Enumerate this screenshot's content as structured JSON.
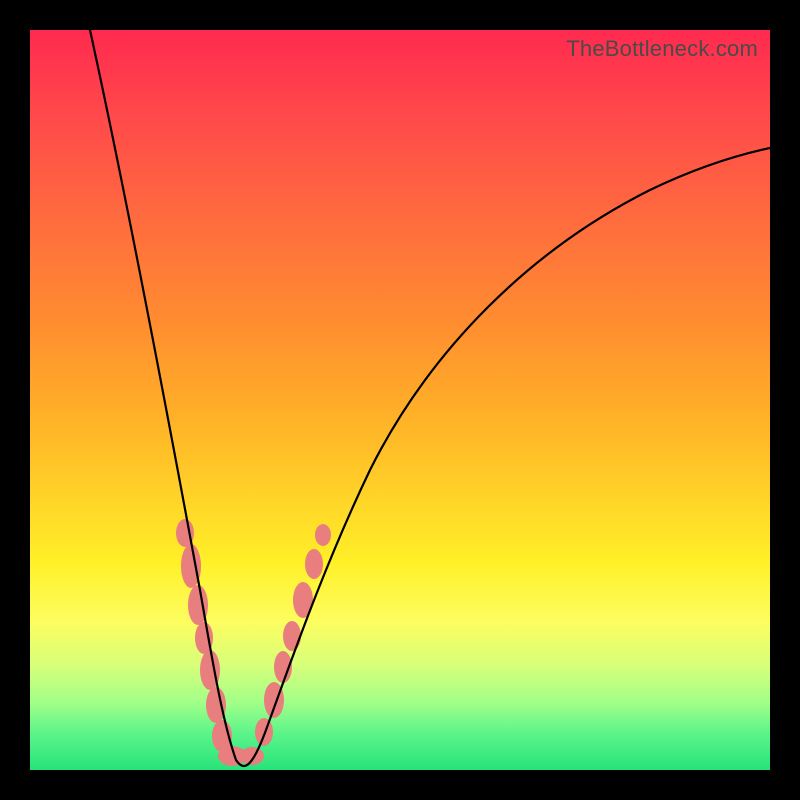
{
  "watermark": "TheBottleneck.com",
  "colors": {
    "frame_border": "#000000",
    "curve": "#000000",
    "blob": "#e97e7e"
  },
  "chart_data": {
    "type": "line",
    "title": "",
    "xlabel": "",
    "ylabel": "",
    "xlim": [
      0,
      100
    ],
    "ylim": [
      0,
      100
    ],
    "minimum_x": 25,
    "annotations": "pink markers clustered near valley on both branches",
    "series": [
      {
        "name": "bottleneck-curve",
        "x": [
          5,
          8,
          11,
          14,
          16,
          18,
          20,
          22,
          23,
          24,
          25,
          26,
          28,
          30,
          33,
          37,
          42,
          48,
          55,
          63,
          72,
          82,
          92,
          100
        ],
        "y": [
          100,
          88,
          75,
          62,
          52,
          42,
          32,
          20,
          12,
          5,
          0,
          4,
          12,
          23,
          35,
          46,
          56,
          64,
          70,
          75,
          79,
          82,
          84,
          85
        ]
      }
    ],
    "markers": [
      {
        "branch": "left",
        "x": 20.5,
        "y": 30
      },
      {
        "branch": "left",
        "x": 21.2,
        "y": 25
      },
      {
        "branch": "left",
        "x": 21.8,
        "y": 21
      },
      {
        "branch": "left",
        "x": 22.4,
        "y": 17
      },
      {
        "branch": "left",
        "x": 23.0,
        "y": 13
      },
      {
        "branch": "left",
        "x": 23.6,
        "y": 9
      },
      {
        "branch": "left",
        "x": 24.2,
        "y": 5
      },
      {
        "branch": "valley",
        "x": 25.0,
        "y": 0
      },
      {
        "branch": "valley",
        "x": 25.8,
        "y": 2
      },
      {
        "branch": "right",
        "x": 26.8,
        "y": 6
      },
      {
        "branch": "right",
        "x": 27.8,
        "y": 11
      },
      {
        "branch": "right",
        "x": 28.8,
        "y": 17
      },
      {
        "branch": "right",
        "x": 29.8,
        "y": 22
      },
      {
        "branch": "right",
        "x": 31.0,
        "y": 28
      },
      {
        "branch": "right",
        "x": 32.2,
        "y": 33
      }
    ]
  }
}
